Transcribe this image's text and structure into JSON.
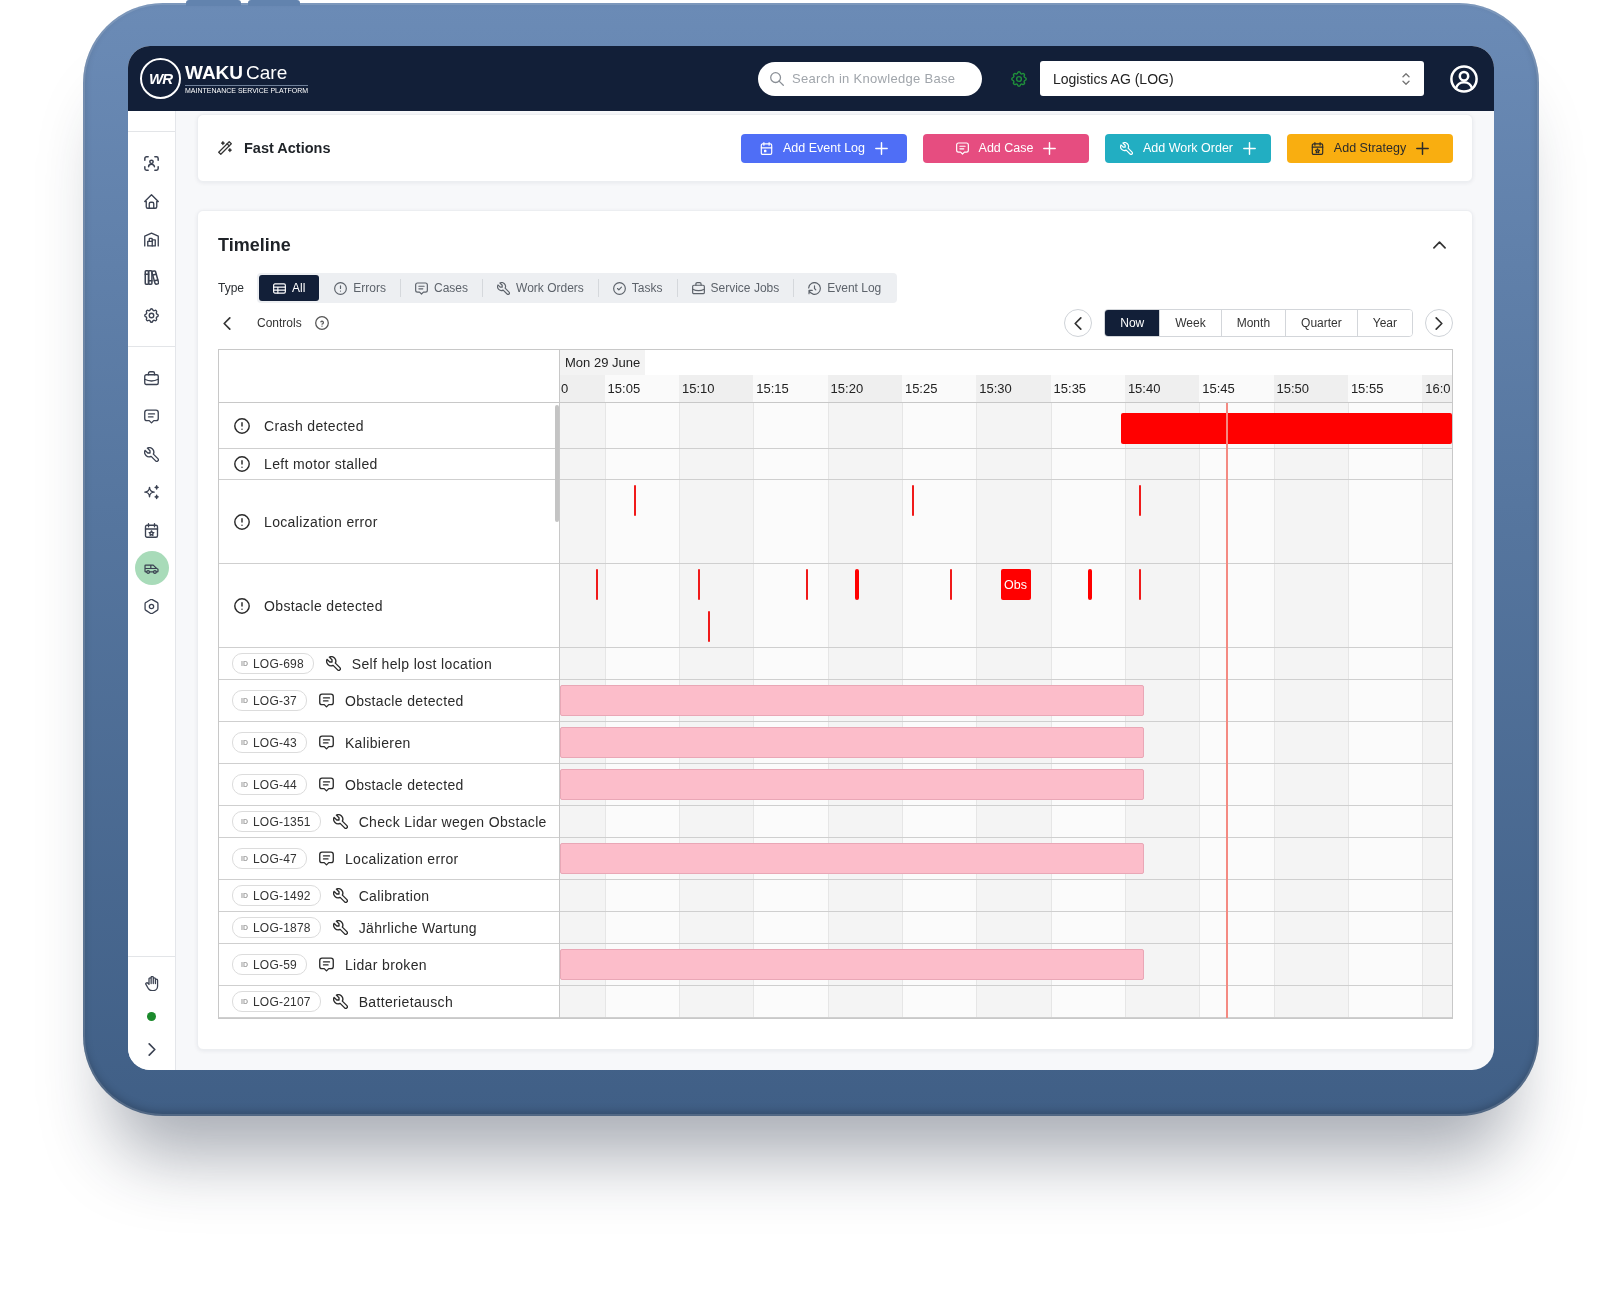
{
  "header": {
    "logo": {
      "mark": "WR",
      "brand": "WAKU",
      "product": "Care",
      "tagline": "MAINTENANCE SERVICE PLATFORM"
    },
    "search": {
      "placeholder": "Search in Knowledge Base"
    },
    "tenant_select": {
      "value": "Logistics AG (LOG)"
    }
  },
  "sidebar": {
    "top_items": [
      {
        "selected": false
      },
      {
        "selected": false
      },
      {
        "selected": false
      },
      {
        "selected": false
      },
      {
        "selected": false
      }
    ],
    "main_items": [
      {
        "selected": false
      },
      {
        "selected": false
      },
      {
        "selected": false
      },
      {
        "selected": false
      },
      {
        "selected": false
      },
      {
        "selected": true
      },
      {
        "selected": false
      }
    ]
  },
  "fast_actions": {
    "title": "Fast Actions",
    "buttons": [
      {
        "kind": "event_log",
        "label": "Add Event Log",
        "color": "#4f6ef6"
      },
      {
        "kind": "case",
        "label": "Add Case",
        "color": "#e64d80"
      },
      {
        "kind": "work_order",
        "label": "Add Work Order",
        "color": "#22aec2"
      },
      {
        "kind": "strategy",
        "label": "Add Strategy",
        "color": "#f9ae10"
      }
    ]
  },
  "timeline": {
    "title": "Timeline",
    "expanded": true,
    "type_filter": {
      "label": "Type",
      "options": [
        {
          "kind": "all",
          "label": "All",
          "selected": true
        },
        {
          "kind": "errors",
          "label": "Errors",
          "selected": false
        },
        {
          "kind": "cases",
          "label": "Cases",
          "selected": false
        },
        {
          "kind": "work_orders",
          "label": "Work Orders",
          "selected": false
        },
        {
          "kind": "tasks",
          "label": "Tasks",
          "selected": false
        },
        {
          "kind": "service_jobs",
          "label": "Service Jobs",
          "selected": false
        },
        {
          "kind": "event_log",
          "label": "Event Log",
          "selected": false
        }
      ]
    },
    "controls": {
      "label": "Controls"
    },
    "range": {
      "options": [
        {
          "label": "Now",
          "selected": true
        },
        {
          "label": "Week",
          "selected": false
        },
        {
          "label": "Month",
          "selected": false
        },
        {
          "label": "Quarter",
          "selected": false
        },
        {
          "label": "Year",
          "selected": false
        }
      ]
    },
    "grid": {
      "date": "Mon 29 June",
      "ticks": [
        "0",
        "15:05",
        "15:10",
        "15:15",
        "15:20",
        "15:25",
        "15:30",
        "15:35",
        "15:40",
        "15:45",
        "15:50",
        "15:55",
        "16:0"
      ],
      "rows": [
        {
          "kind": "error",
          "title": "Crash detected"
        },
        {
          "kind": "error",
          "title": "Left motor stalled"
        },
        {
          "kind": "error",
          "title": "Localization error"
        },
        {
          "kind": "error",
          "title": "Obstacle detected",
          "event_label": "Obs"
        },
        {
          "kind": "work_order",
          "id_prefix": "ID",
          "id": "LOG-698",
          "title": "Self help lost location"
        },
        {
          "kind": "case",
          "id_prefix": "ID",
          "id": "LOG-37",
          "title": "Obstacle detected"
        },
        {
          "kind": "case",
          "id_prefix": "ID",
          "id": "LOG-43",
          "title": "Kalibieren"
        },
        {
          "kind": "case",
          "id_prefix": "ID",
          "id": "LOG-44",
          "title": "Obstacle detected"
        },
        {
          "kind": "work_order",
          "id_prefix": "ID",
          "id": "LOG-1351",
          "title": "Check Lidar wegen Obstacle"
        },
        {
          "kind": "case",
          "id_prefix": "ID",
          "id": "LOG-47",
          "title": "Localization error"
        },
        {
          "kind": "work_order",
          "id_prefix": "ID",
          "id": "LOG-1492",
          "title": "Calibration"
        },
        {
          "kind": "work_order",
          "id_prefix": "ID",
          "id": "LOG-1878",
          "title": "Jährliche Wartung"
        },
        {
          "kind": "case",
          "id_prefix": "ID",
          "id": "LOG-59",
          "title": "Lidar broken"
        },
        {
          "kind": "work_order",
          "id_prefix": "ID",
          "id": "LOG-2107",
          "title": "Batterietausch"
        }
      ]
    }
  }
}
